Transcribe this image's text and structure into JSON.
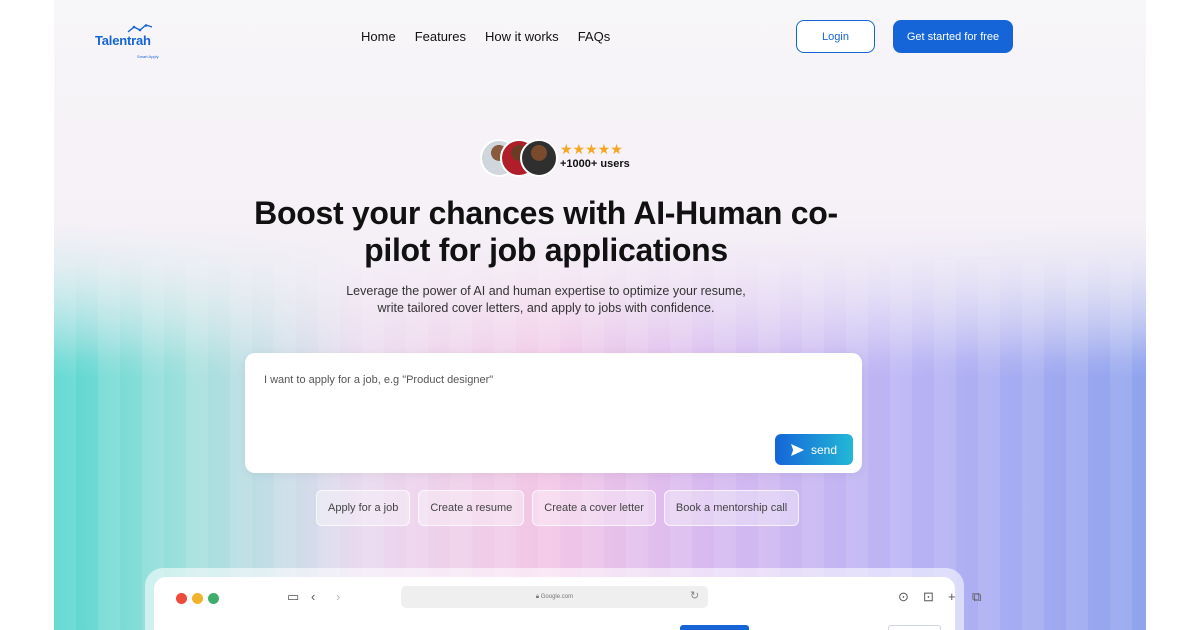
{
  "header": {
    "logo_text": "Talentrah",
    "logo_tagline": "Smart Apply",
    "nav": [
      {
        "label": "Home"
      },
      {
        "label": "Features"
      },
      {
        "label": "How it works"
      },
      {
        "label": "FAQs"
      }
    ],
    "login_label": "Login",
    "cta_label": "Get started for free"
  },
  "social_proof": {
    "stars": "★★★★★",
    "rating": 5,
    "users_label": "+1000+ users"
  },
  "hero": {
    "headline": "Boost your chances with AI-Human co-pilot for job applications",
    "subtext": "Leverage the power of AI and human expertise to optimize your resume, write tailored cover letters, and apply to jobs with confidence."
  },
  "prompt": {
    "placeholder": "I want to apply for a job, e.g \"Product designer\"",
    "send_label": "send",
    "send_icon": "paper-plane-icon"
  },
  "chips": [
    {
      "label": "Apply for a job"
    },
    {
      "label": "Create a resume"
    },
    {
      "label": "Create a cover letter"
    },
    {
      "label": "Book a mentorship call"
    }
  ],
  "browser_mockup": {
    "address": "Google.com",
    "traffic_lights": [
      "#ee4b3b",
      "#f2b32a",
      "#3fae6a"
    ]
  },
  "colors": {
    "brand": "#1565d8",
    "star": "#f5a623"
  }
}
